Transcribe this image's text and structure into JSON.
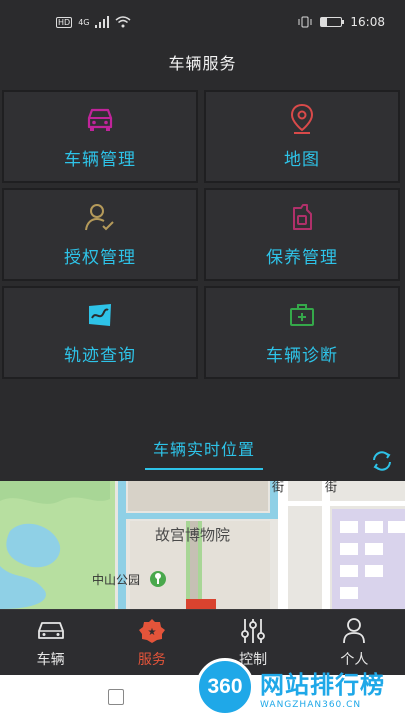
{
  "status": {
    "network": "4G",
    "hd": "HD",
    "time": "16:08"
  },
  "header": {
    "title": "车辆服务"
  },
  "tiles": [
    {
      "label": "车辆管理",
      "icon": "car-icon",
      "color": "#c0249a"
    },
    {
      "label": "地图",
      "icon": "map-pin-icon",
      "color": "#d94a4a"
    },
    {
      "label": "授权管理",
      "icon": "user-check-icon",
      "color": "#b59a5a"
    },
    {
      "label": "保养管理",
      "icon": "oil-can-icon",
      "color": "#b0306a"
    },
    {
      "label": "轨迹查询",
      "icon": "track-map-icon",
      "color": "#2ec3e8"
    },
    {
      "label": "车辆诊断",
      "icon": "medkit-icon",
      "color": "#35a84a"
    }
  ],
  "location": {
    "tab_label": "车辆实时位置",
    "refresh_icon": "refresh-icon",
    "accent": "#2ec3e8"
  },
  "map": {
    "poi_museum": "故宫博物院",
    "poi_park": "中山公园",
    "street_1": "街",
    "street_2": "街"
  },
  "tabbar": {
    "items": [
      {
        "label": "车辆",
        "icon": "car-outline-icon",
        "active": false
      },
      {
        "label": "服务",
        "icon": "service-badge-icon",
        "active": true
      },
      {
        "label": "控制",
        "icon": "sliders-icon",
        "active": false
      },
      {
        "label": "个人",
        "icon": "person-icon",
        "active": false
      }
    ],
    "active_color": "#e4543a"
  },
  "watermark": {
    "circle": "360",
    "main": "网站排行榜",
    "sub": "WANGZHAN360.CN"
  }
}
